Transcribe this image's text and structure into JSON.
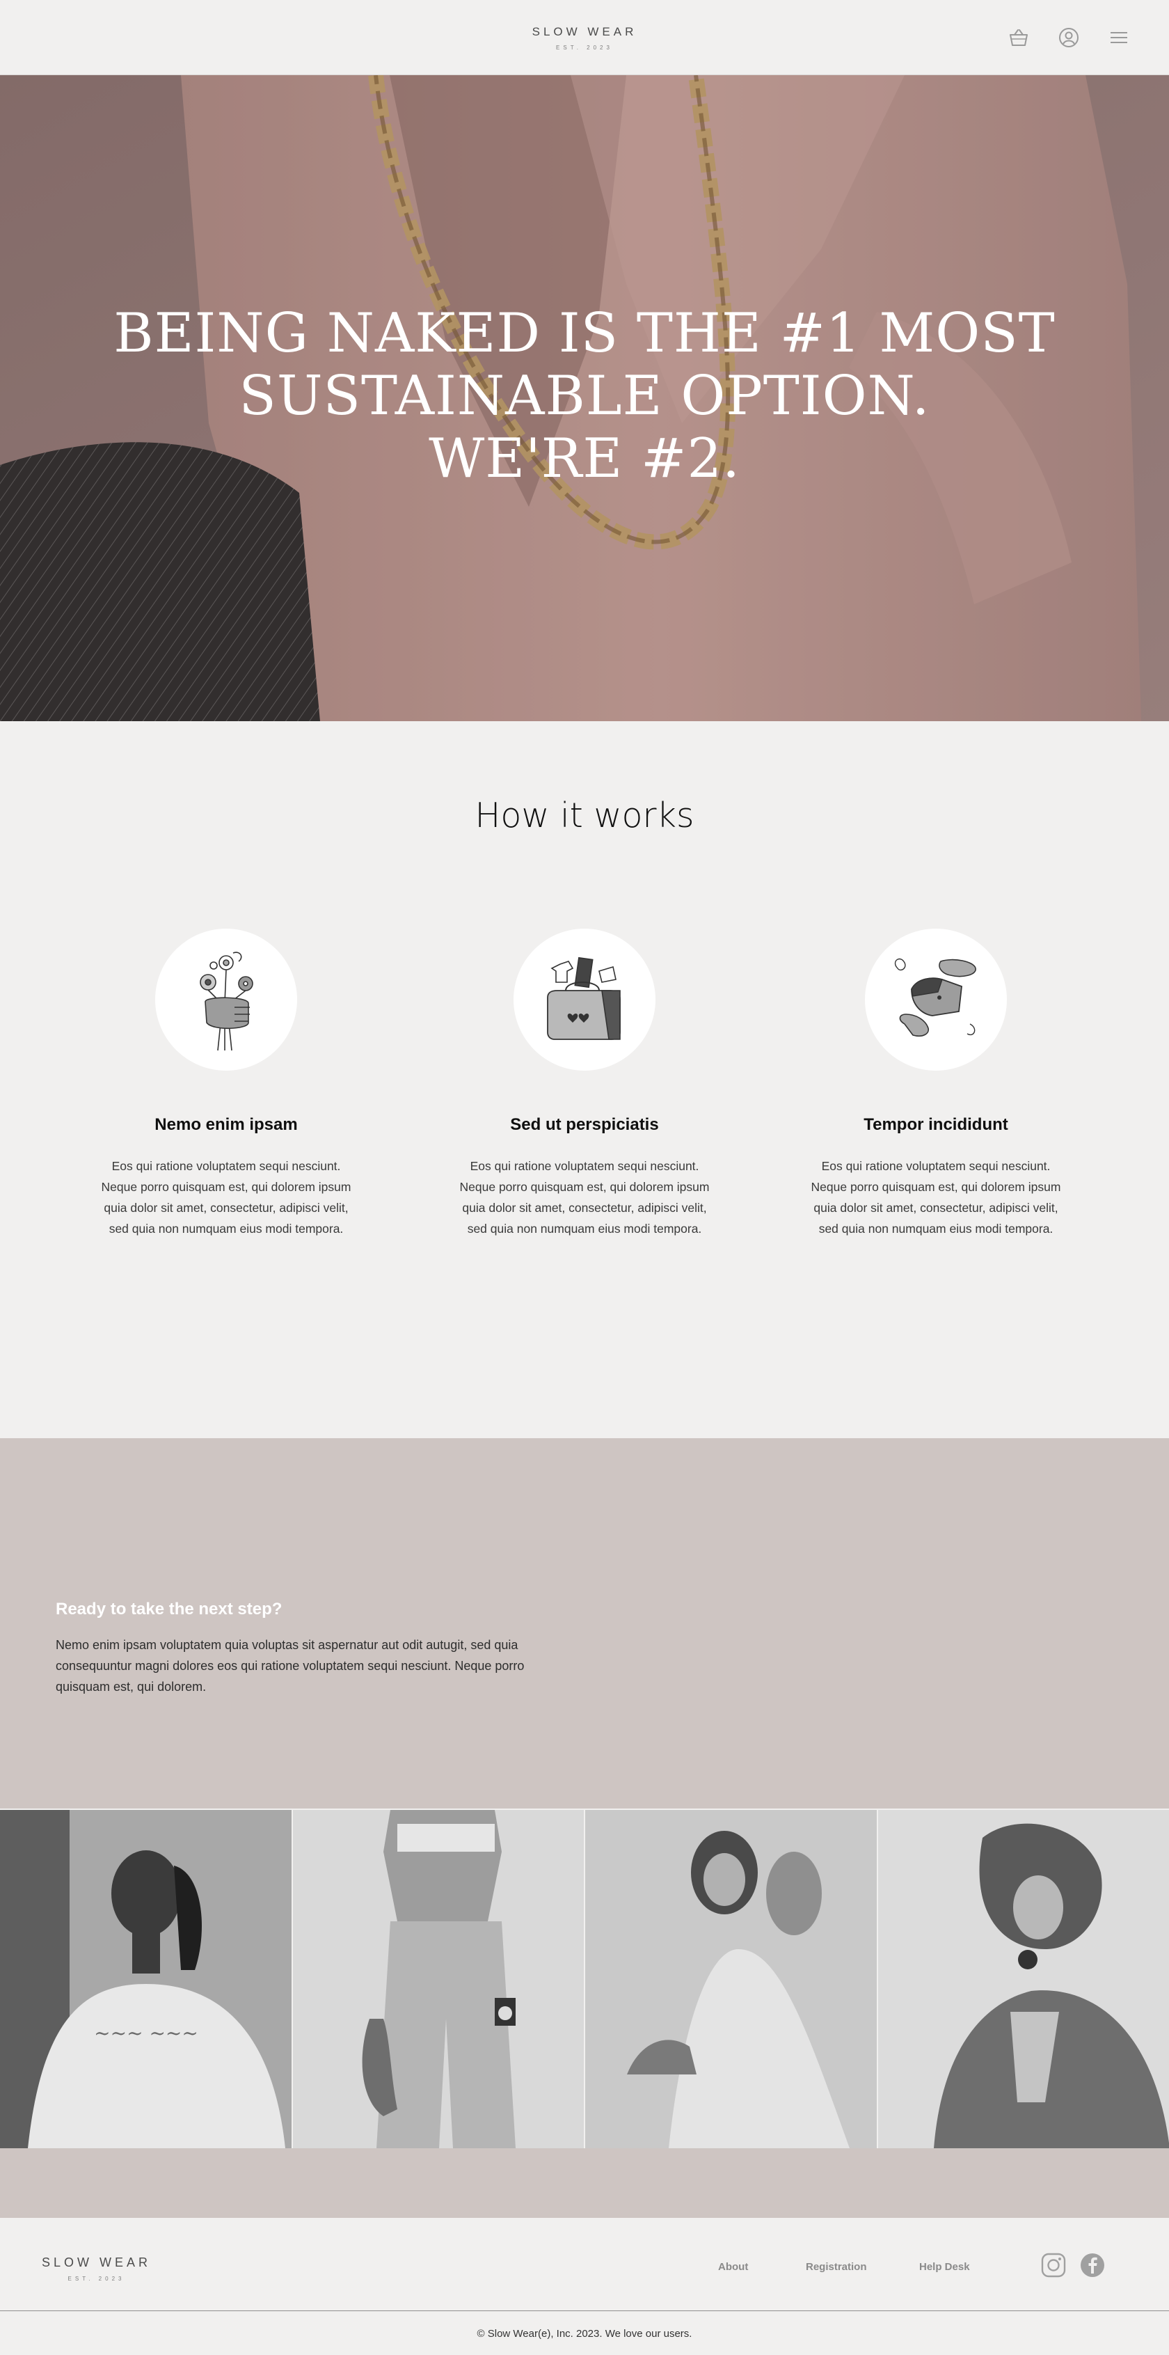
{
  "header": {
    "brand_name": "SLOW WEAR",
    "brand_est": "EST. 2023",
    "icons": [
      "basket-icon",
      "user-icon",
      "menu-icon"
    ]
  },
  "hero": {
    "line1": "BEING NAKED IS THE #1 MOST",
    "line2": "SUSTAINABLE OPTION.",
    "line3": "WE'RE #2."
  },
  "how": {
    "title": "How it works",
    "steps": [
      {
        "icon": "flower-bouquet-icon",
        "title": "Nemo enim ipsam",
        "text": "Eos qui ratione voluptatem sequi nesciunt. Neque porro quisquam est, qui dolorem ipsum quia dolor sit amet, consectetur, adipisci velit, sed quia non numquam eius modi tempora."
      },
      {
        "icon": "clothes-bag-icon",
        "title": "Sed ut perspiciatis",
        "text": "Eos qui ratione voluptatem sequi nesciunt. Neque porro quisquam est, qui dolorem ipsum quia dolor sit amet, consectetur, adipisci velit, sed quia non numquam eius modi tempora."
      },
      {
        "icon": "hands-bag-icon",
        "title": "Tempor incididunt",
        "text": "Eos qui ratione voluptatem sequi nesciunt. Neque porro quisquam est, qui dolorem ipsum quia dolor sit amet, consectetur, adipisci velit, sed quia non numquam eius modi tempora."
      }
    ]
  },
  "cta": {
    "title": "Ready to take the next step?",
    "text": "Nemo enim ipsam voluptatem quia voluptas sit aspernatur aut odit autugit, sed quia consequuntur magni dolores eos qui ratione voluptatem sequi nesciunt. Neque porro quisquam est, qui dolorem."
  },
  "footer": {
    "brand_name": "SLOW WEAR",
    "brand_est": "EST. 2023",
    "nav": [
      "About",
      "Registration",
      "Help Desk"
    ],
    "social": [
      "instagram-icon",
      "facebook-icon"
    ],
    "copyright": "© Slow Wear(e), Inc. 2023. We love our users."
  },
  "colors": {
    "background": "#f1f0ef",
    "accent": "#cec5c2",
    "hero_tint": "#a58a86"
  }
}
